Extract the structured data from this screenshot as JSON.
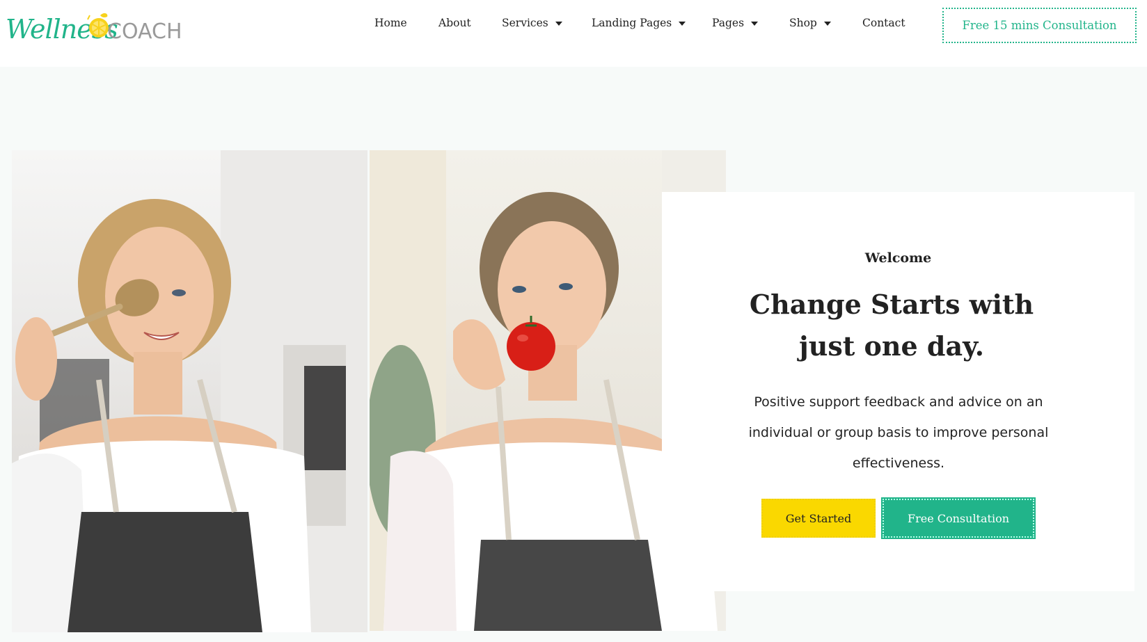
{
  "brand": {
    "logo_text": "WellnessCOACH",
    "accent": "#21b48a",
    "yellow": "#fad800"
  },
  "nav": {
    "items": [
      {
        "label": "Home",
        "dropdown": false
      },
      {
        "label": "About",
        "dropdown": false
      },
      {
        "label": "Services",
        "dropdown": true
      },
      {
        "label": "Landing Pages",
        "dropdown": true
      },
      {
        "label": "Pages",
        "dropdown": true
      },
      {
        "label": "Shop",
        "dropdown": true
      },
      {
        "label": "Contact",
        "dropdown": false
      }
    ],
    "cta_label": "Free 15 mins Consultation"
  },
  "hero": {
    "welcome": "Welcome",
    "headline": "Change Starts with just one day.",
    "description": "Positive support feedback and advice on an individual or group basis to improve personal effectiveness.",
    "primary_button": "Get Started",
    "secondary_button": "Free Consultation"
  }
}
